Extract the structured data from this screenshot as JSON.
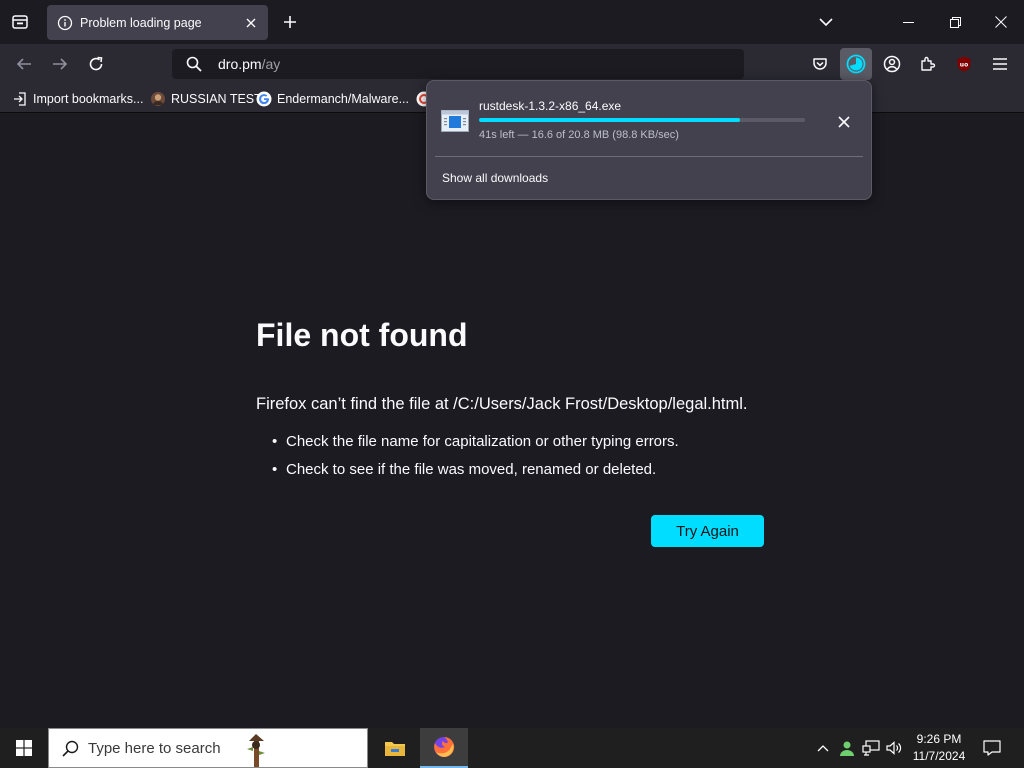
{
  "tab": {
    "title": "Problem loading page"
  },
  "address_bar": {
    "host": "dro.pm",
    "path": "/ay"
  },
  "bookmarks": [
    {
      "label": "Import bookmarks..."
    },
    {
      "label": "RUSSIAN TEST"
    },
    {
      "label": "Endermanch/Malware..."
    },
    {
      "label": ""
    }
  ],
  "error_page": {
    "title": "File not found",
    "description": "Firefox can’t find the file at /C:/Users/Jack Frost/Desktop/legal.html.",
    "suggestions": [
      "Check the file name for capitalization or other typing errors.",
      "Check to see if the file was moved, renamed or deleted."
    ],
    "try_again_label": "Try Again"
  },
  "downloads_panel": {
    "filename": "rustdesk-1.3.2-x86_64.exe",
    "progress": 0.8,
    "status": "41s left — 16.6 of 20.8 MB (98.8 KB/sec)",
    "show_all_label": "Show all downloads"
  },
  "taskbar": {
    "search_placeholder": "Type here to search",
    "time": "9:26 PM",
    "date": "11/7/2024"
  },
  "colors": {
    "accent": "#00ddff",
    "page_bg": "#1c1b22",
    "toolbar_bg": "#2b2a33",
    "panel_bg": "#42414d"
  },
  "icons": {
    "tab": "info-icon",
    "downloads": "download-progress-icon",
    "ublock": "ublock-origin-icon"
  }
}
